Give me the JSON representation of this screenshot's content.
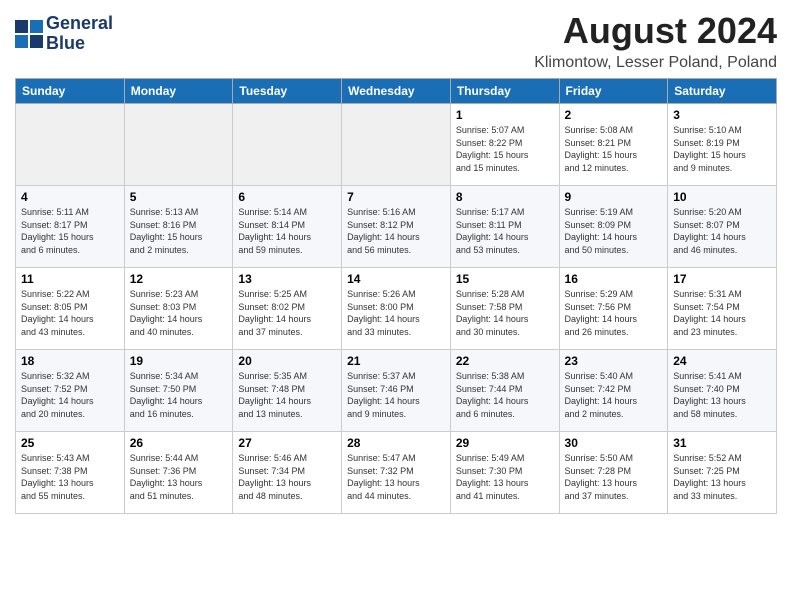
{
  "logo": {
    "line1": "General",
    "line2": "Blue"
  },
  "title": "August 2024",
  "subtitle": "Klimontow, Lesser Poland, Poland",
  "weekdays": [
    "Sunday",
    "Monday",
    "Tuesday",
    "Wednesday",
    "Thursday",
    "Friday",
    "Saturday"
  ],
  "weeks": [
    [
      {
        "day": "",
        "info": ""
      },
      {
        "day": "",
        "info": ""
      },
      {
        "day": "",
        "info": ""
      },
      {
        "day": "",
        "info": ""
      },
      {
        "day": "1",
        "info": "Sunrise: 5:07 AM\nSunset: 8:22 PM\nDaylight: 15 hours\nand 15 minutes."
      },
      {
        "day": "2",
        "info": "Sunrise: 5:08 AM\nSunset: 8:21 PM\nDaylight: 15 hours\nand 12 minutes."
      },
      {
        "day": "3",
        "info": "Sunrise: 5:10 AM\nSunset: 8:19 PM\nDaylight: 15 hours\nand 9 minutes."
      }
    ],
    [
      {
        "day": "4",
        "info": "Sunrise: 5:11 AM\nSunset: 8:17 PM\nDaylight: 15 hours\nand 6 minutes."
      },
      {
        "day": "5",
        "info": "Sunrise: 5:13 AM\nSunset: 8:16 PM\nDaylight: 15 hours\nand 2 minutes."
      },
      {
        "day": "6",
        "info": "Sunrise: 5:14 AM\nSunset: 8:14 PM\nDaylight: 14 hours\nand 59 minutes."
      },
      {
        "day": "7",
        "info": "Sunrise: 5:16 AM\nSunset: 8:12 PM\nDaylight: 14 hours\nand 56 minutes."
      },
      {
        "day": "8",
        "info": "Sunrise: 5:17 AM\nSunset: 8:11 PM\nDaylight: 14 hours\nand 53 minutes."
      },
      {
        "day": "9",
        "info": "Sunrise: 5:19 AM\nSunset: 8:09 PM\nDaylight: 14 hours\nand 50 minutes."
      },
      {
        "day": "10",
        "info": "Sunrise: 5:20 AM\nSunset: 8:07 PM\nDaylight: 14 hours\nand 46 minutes."
      }
    ],
    [
      {
        "day": "11",
        "info": "Sunrise: 5:22 AM\nSunset: 8:05 PM\nDaylight: 14 hours\nand 43 minutes."
      },
      {
        "day": "12",
        "info": "Sunrise: 5:23 AM\nSunset: 8:03 PM\nDaylight: 14 hours\nand 40 minutes."
      },
      {
        "day": "13",
        "info": "Sunrise: 5:25 AM\nSunset: 8:02 PM\nDaylight: 14 hours\nand 37 minutes."
      },
      {
        "day": "14",
        "info": "Sunrise: 5:26 AM\nSunset: 8:00 PM\nDaylight: 14 hours\nand 33 minutes."
      },
      {
        "day": "15",
        "info": "Sunrise: 5:28 AM\nSunset: 7:58 PM\nDaylight: 14 hours\nand 30 minutes."
      },
      {
        "day": "16",
        "info": "Sunrise: 5:29 AM\nSunset: 7:56 PM\nDaylight: 14 hours\nand 26 minutes."
      },
      {
        "day": "17",
        "info": "Sunrise: 5:31 AM\nSunset: 7:54 PM\nDaylight: 14 hours\nand 23 minutes."
      }
    ],
    [
      {
        "day": "18",
        "info": "Sunrise: 5:32 AM\nSunset: 7:52 PM\nDaylight: 14 hours\nand 20 minutes."
      },
      {
        "day": "19",
        "info": "Sunrise: 5:34 AM\nSunset: 7:50 PM\nDaylight: 14 hours\nand 16 minutes."
      },
      {
        "day": "20",
        "info": "Sunrise: 5:35 AM\nSunset: 7:48 PM\nDaylight: 14 hours\nand 13 minutes."
      },
      {
        "day": "21",
        "info": "Sunrise: 5:37 AM\nSunset: 7:46 PM\nDaylight: 14 hours\nand 9 minutes."
      },
      {
        "day": "22",
        "info": "Sunrise: 5:38 AM\nSunset: 7:44 PM\nDaylight: 14 hours\nand 6 minutes."
      },
      {
        "day": "23",
        "info": "Sunrise: 5:40 AM\nSunset: 7:42 PM\nDaylight: 14 hours\nand 2 minutes."
      },
      {
        "day": "24",
        "info": "Sunrise: 5:41 AM\nSunset: 7:40 PM\nDaylight: 13 hours\nand 58 minutes."
      }
    ],
    [
      {
        "day": "25",
        "info": "Sunrise: 5:43 AM\nSunset: 7:38 PM\nDaylight: 13 hours\nand 55 minutes."
      },
      {
        "day": "26",
        "info": "Sunrise: 5:44 AM\nSunset: 7:36 PM\nDaylight: 13 hours\nand 51 minutes."
      },
      {
        "day": "27",
        "info": "Sunrise: 5:46 AM\nSunset: 7:34 PM\nDaylight: 13 hours\nand 48 minutes."
      },
      {
        "day": "28",
        "info": "Sunrise: 5:47 AM\nSunset: 7:32 PM\nDaylight: 13 hours\nand 44 minutes."
      },
      {
        "day": "29",
        "info": "Sunrise: 5:49 AM\nSunset: 7:30 PM\nDaylight: 13 hours\nand 41 minutes."
      },
      {
        "day": "30",
        "info": "Sunrise: 5:50 AM\nSunset: 7:28 PM\nDaylight: 13 hours\nand 37 minutes."
      },
      {
        "day": "31",
        "info": "Sunrise: 5:52 AM\nSunset: 7:25 PM\nDaylight: 13 hours\nand 33 minutes."
      }
    ]
  ]
}
